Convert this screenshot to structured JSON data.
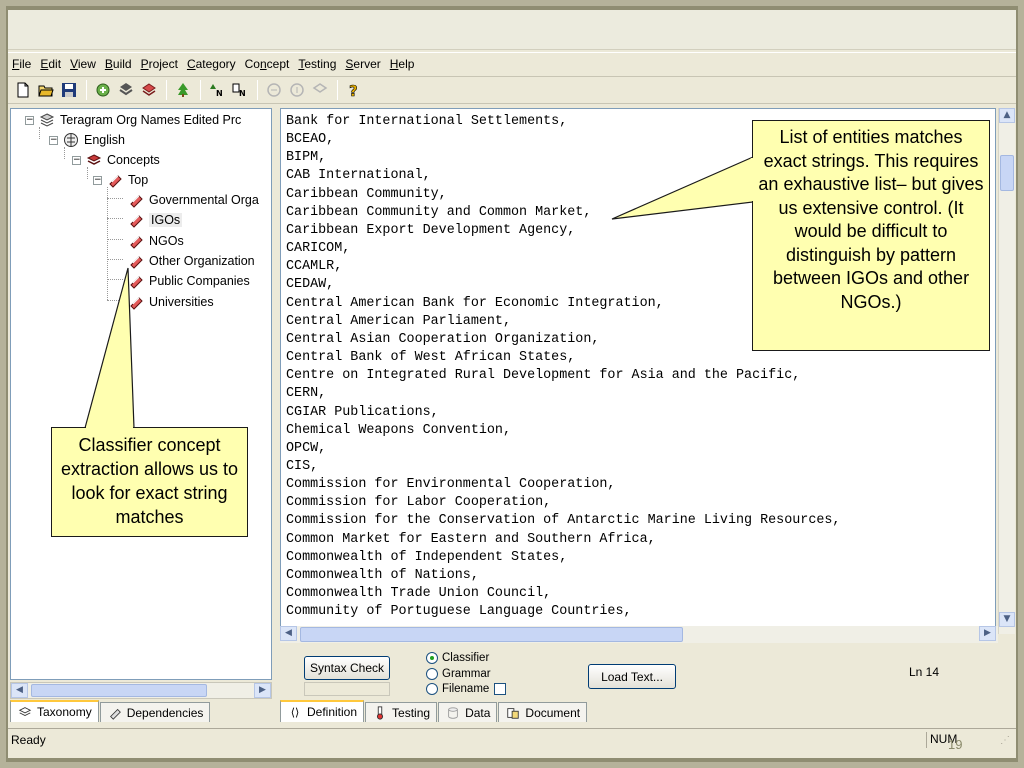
{
  "menu": [
    "File",
    "Edit",
    "View",
    "Build",
    "Project",
    "Category",
    "Concept",
    "Testing",
    "Server",
    "Help"
  ],
  "menu_underline": [
    "F",
    "E",
    "V",
    "B",
    "P",
    "C",
    "n",
    "T",
    "S",
    "H"
  ],
  "tree": {
    "root": "Teragram Org Names Edited Prc",
    "english": "English",
    "concepts": "Concepts",
    "top": "Top",
    "items": [
      "Governmental Orga",
      "IGOs",
      "NGOs",
      "Other Organization",
      "Public Companies",
      "Universities"
    ]
  },
  "left_tabs": [
    "Taxonomy",
    "Dependencies"
  ],
  "editor_lines": [
    "Bank for International Settlements,",
    "BCEAO,",
    "BIPM,",
    "CAB International,",
    "Caribbean Community,",
    "Caribbean Community and Common Market,",
    "Caribbean Export Development Agency,",
    "CARICOM,",
    "CCAMLR,",
    "CEDAW,",
    "Central American Bank for Economic Integration,",
    "Central American Parliament,",
    "Central Asian Cooperation Organization,",
    "Central Bank of West African States,",
    "Centre on Integrated Rural Development for Asia and the Pacific,",
    "CERN,",
    "CGIAR Publications,",
    "Chemical Weapons Convention,",
    "OPCW,",
    "CIS,",
    "Commission for Environmental Cooperation,",
    "Commission for Labor Cooperation,",
    "Commission for the Conservation of Antarctic Marine Living Resources,",
    "Common Market for Eastern and Southern Africa,",
    "Commonwealth of Independent States,",
    "Commonwealth of Nations,",
    "Commonwealth Trade Union Council,",
    "Community of Portuguese Language Countries,"
  ],
  "controls": {
    "syntax_check": "Syntax Check",
    "radios": [
      "Classifier",
      "Grammar",
      "Filename"
    ],
    "load_text": "Load Text...",
    "line_indicator": "Ln 14"
  },
  "bottom_tabs": [
    "Definition",
    "Testing",
    "Data",
    "Document"
  ],
  "status": {
    "left": "Ready",
    "num": "NUM",
    "page_number": "19"
  },
  "callouts": {
    "left": "Classifier concept extraction allows us to look for exact string matches",
    "right": "List of entities matches exact strings.  This requires an exhaustive list– but gives us extensive control.  (It would be difficult to distinguish by pattern between IGOs and other NGOs.)"
  }
}
